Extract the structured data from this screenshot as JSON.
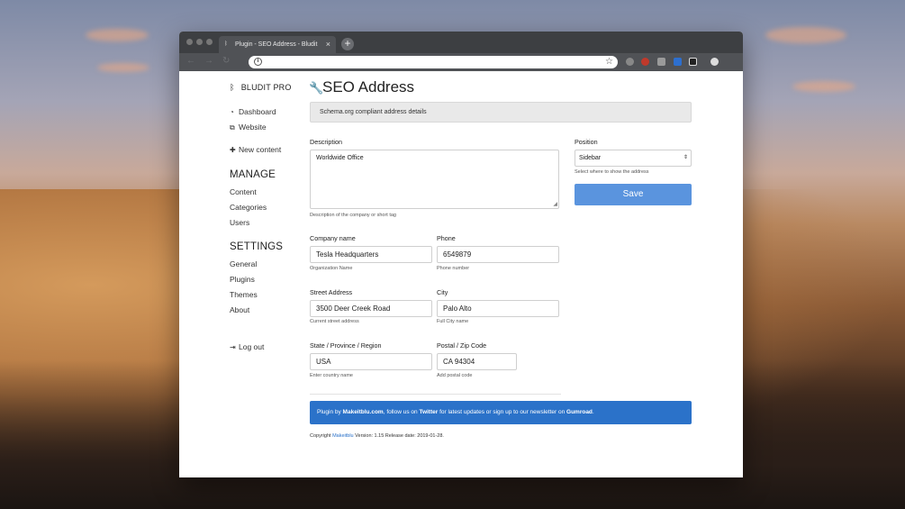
{
  "browser": {
    "tab_title": "Plugin - SEO Address - Bludit",
    "tab_close": "×",
    "new_tab": "+"
  },
  "sidebar": {
    "brand": "BLUDIT PRO",
    "dashboard": "Dashboard",
    "website": "Website",
    "new_content": "New content",
    "manage_heading": "MANAGE",
    "manage_items": [
      "Content",
      "Categories",
      "Users"
    ],
    "settings_heading": "SETTINGS",
    "settings_items": [
      "General",
      "Plugins",
      "Themes",
      "About"
    ],
    "logout": "Log out"
  },
  "main": {
    "title": "SEO Address",
    "notice": "Schema.org compliant address details",
    "description": {
      "label": "Description",
      "value": "Worldwide Office",
      "hint": "Description of the company or short tag"
    },
    "position": {
      "label": "Position",
      "selected": "Sidebar",
      "hint": "Select where to show the address"
    },
    "save_label": "Save",
    "company": {
      "label": "Company name",
      "value": "Tesla Headquarters",
      "hint": "Organization Name"
    },
    "phone": {
      "label": "Phone",
      "value": "6549879",
      "hint": "Phone number"
    },
    "street": {
      "label": "Street Address",
      "value": "3500 Deer Creek Road",
      "hint": "Current street address"
    },
    "city": {
      "label": "City",
      "value": "Palo Alto",
      "hint": "Full City name"
    },
    "state": {
      "label": "State / Province / Region",
      "value": "USA",
      "hint": "Enter country name"
    },
    "postal": {
      "label": "Postal / Zip Code",
      "value": "CA 94304",
      "hint": "Add postal code"
    },
    "banner": {
      "prefix": "Plugin by ",
      "author": "Makeitblu.com",
      "mid1": ", follow us on ",
      "twitter": "Twitter",
      "mid2": " for latest updates or sign up to our newsletter on ",
      "gumroad": "Gumroad",
      "end": "."
    },
    "copyright": {
      "prefix": "Copyright ",
      "link": "Makeitblu",
      "rest": " Version: 1.15 Release date: 2019-01-28."
    }
  },
  "colors": {
    "accent": "#2b72c9",
    "save_button": "#5a94de",
    "notice_bg": "#e9e9e9"
  },
  "icons": [
    "bludit-logo-icon",
    "wrench-icon",
    "dashboard-icon",
    "external-link-icon",
    "plus-icon",
    "logout-icon",
    "info-icon",
    "star-icon"
  ]
}
